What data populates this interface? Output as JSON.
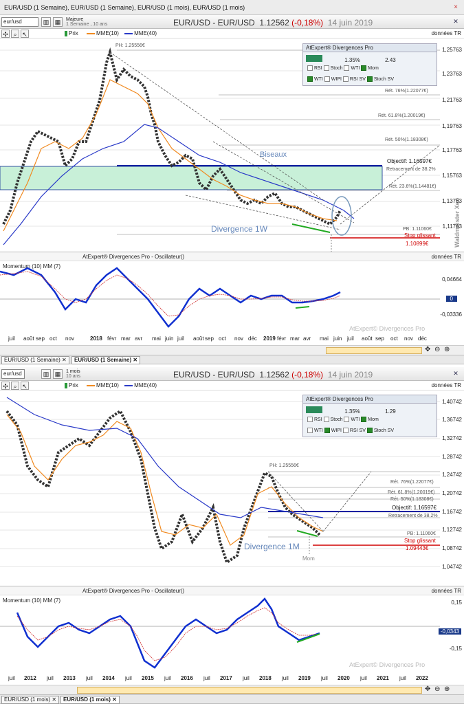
{
  "window": {
    "title": "EUR/USD (1 Semaine), EUR/USD (1 Semaine), EUR/USD (1 mois), EUR/USD (1 mois)",
    "close": "×"
  },
  "top": {
    "symbol": "eur/usd",
    "period_label": "Majeure",
    "period_sub": "1 Semaine , 10 ans",
    "legend": {
      "price": "Prix",
      "mme10": "MME(10)",
      "mme40": "MME(40)"
    },
    "chart_title": "EUR/USD - EUR/USD",
    "price": "1.12562",
    "change": "(-0,18%)",
    "date": "14 juin 2019",
    "source": "données TR",
    "yticks": [
      "1,25763",
      "1,23763",
      "1,21763",
      "1,19763",
      "1,17763",
      "1,15763",
      "1,13763",
      "1,11763"
    ],
    "annotations": {
      "ph": "PH: 1.25556€",
      "ret76": "Rét. 76%(1.22077€)",
      "ret618": "Rét. 61.8%(1.20019€)",
      "ret50": "Rét. 50%(1.18308€)",
      "objectif": "Objectif: 1.16597€",
      "retracement": "Retracement de 38.2%",
      "ret236": "Rét. 23.6%(1.14481€)",
      "pb": "PB: 1.11060€",
      "stop": "Stop glissant",
      "stop_val": "1.10899€",
      "biseaux": "Biseaux",
      "divergence": "Divergence 1W"
    },
    "panel": {
      "title": "AtExpert® Divergences Pro",
      "pct": "1.35%",
      "val": "2.43",
      "rsi": "RSI",
      "stoch": "Stoch",
      "wti": "WTI",
      "mom": "Mom",
      "rsisv": "RSI SV",
      "wipi": "WIPI",
      "stochsv": "Stoch SV"
    },
    "osc": {
      "title": "AtExpert® Divergences Pro - Oscillateur()",
      "source": "données TR",
      "momentum": "Momentum (10) MM (7)",
      "yhigh": "0,04664",
      "ylow": "-0,03336",
      "zero": "0",
      "watermark": "AtExpert© Divergences Pro"
    },
    "xlabels": [
      "juil",
      "août",
      "sep",
      "oct",
      "nov",
      "2018",
      "févr",
      "mar",
      "avr",
      "mai",
      "juin",
      "juil",
      "août",
      "sep",
      "oct",
      "nov",
      "déc",
      "2019",
      "févr",
      "mar",
      "avr",
      "mai",
      "juin",
      "juil",
      "août",
      "sep",
      "oct",
      "nov",
      "déc"
    ],
    "tabs": [
      "EUR/USD (1 Semaine)",
      "EUR/USD (1 Semaine)"
    ]
  },
  "bottom": {
    "symbol": "eur/usd",
    "period_label": "1 mois",
    "period_sub": "10 ans",
    "legend": {
      "price": "Prix",
      "mme10": "MME(10)",
      "mme40": "MME(40)"
    },
    "chart_title": "EUR/USD - EUR/USD",
    "price": "1.12562",
    "change": "(-0,18%)",
    "date": "14 juin 2019",
    "source": "données TR",
    "yticks": [
      "1,40742",
      "1,36742",
      "1,32742",
      "1,28742",
      "1,24742",
      "1,20742",
      "1,16742",
      "1,12742",
      "1,08742",
      "1,04742"
    ],
    "annotations": {
      "ph": "PH: 1.25556€",
      "ret76": "Rét. 76%(1.22077€)",
      "ret618": "Rét. 61.8%(1.20019€)",
      "ret50": "Rét. 50%(1.18308€)",
      "objectif": "Objectif: 1.16597€",
      "retracement": "Retracement de 38.2%",
      "pb": "PB: 1.11060€",
      "stop": "Stop glissant",
      "stop_val": "1.09443€",
      "divergence": "Divergence 1M",
      "mom": "Mom"
    },
    "panel": {
      "title": "AtExpert® Divergences Pro",
      "pct": "1.35%",
      "val": "1.29",
      "rsi": "RSI",
      "stoch": "Stoch",
      "wti": "WTI",
      "mom": "Mom",
      "rsisv": "RSI SV",
      "wipi": "WIPI",
      "stochsv": "Stoch SV"
    },
    "osc": {
      "title": "AtExpert® Divergences Pro - Oscillateur()",
      "source": "données TR",
      "momentum": "Momentum (10) MM (7)",
      "yhigh": "0,15",
      "ylow": "-0,15",
      "zero": "-0,0343",
      "watermark": "AtExpert© Divergences Pro"
    },
    "xlabels": [
      "juil",
      "2012",
      "juil",
      "2013",
      "juil",
      "2014",
      "juil",
      "2015",
      "juil",
      "2016",
      "juil",
      "2017",
      "juil",
      "2018",
      "juil",
      "2019",
      "juil",
      "2020",
      "juil",
      "2021",
      "juil",
      "2022"
    ],
    "tabs": [
      "EUR/USD (1 mois)",
      "EUR/USD (1 mois)"
    ]
  },
  "watermark_side": "Waldmeister Xeo",
  "colors": {
    "up": "#2a9a3a",
    "down": "#c82020",
    "mme10": "#f08a20",
    "mme40": "#2a3ac8",
    "osc": "#1030d0",
    "zone": "#c8f0d8",
    "stop": "#d00000",
    "objective": "#1020a0"
  }
}
